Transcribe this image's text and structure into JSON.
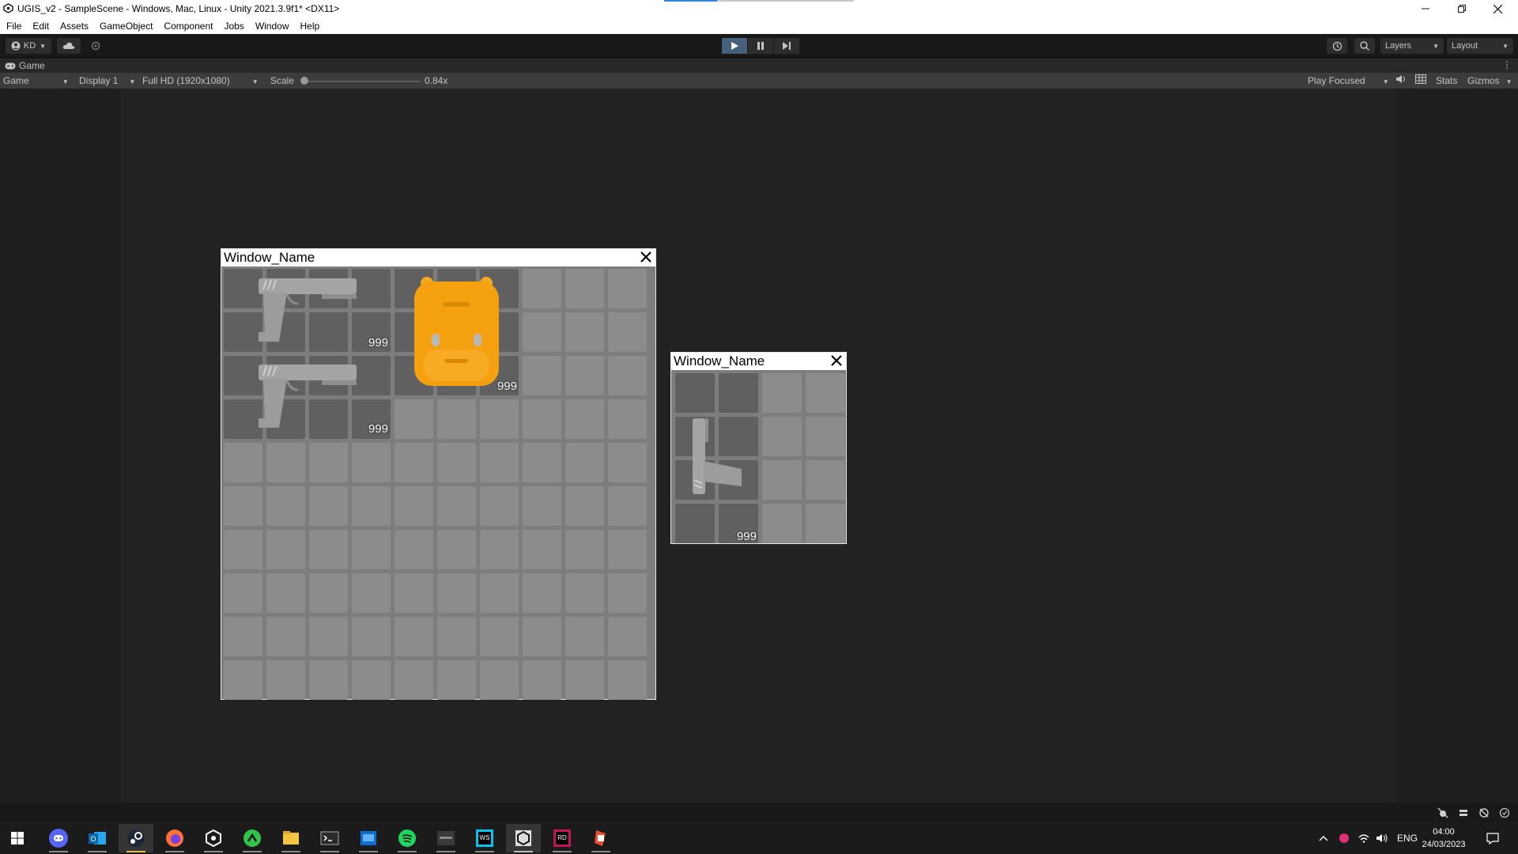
{
  "window": {
    "title": "UGIS_v2 - SampleScene - Windows, Mac, Linux - Unity 2021.3.9f1* <DX11>",
    "loading_progress": 0.28
  },
  "menu": [
    "File",
    "Edit",
    "Assets",
    "GameObject",
    "Component",
    "Jobs",
    "Window",
    "Help"
  ],
  "toolbar": {
    "account": "KD",
    "layers_label": "Layers",
    "layout_label": "Layout",
    "play_state": "playing"
  },
  "game_tab": {
    "label": "Game"
  },
  "game_bar": {
    "view_mode": "Game",
    "display": "Display 1",
    "resolution": "Full HD (1920x1080)",
    "scale_label": "Scale",
    "scale_value": "0.84x",
    "play_mode": "Play Focused",
    "stats": "Stats",
    "gizmos": "Gizmos"
  },
  "inventories": [
    {
      "name": "Window_Name",
      "columns": 10,
      "rows": 10,
      "occupied": [
        [
          0,
          0
        ],
        [
          1,
          0
        ],
        [
          2,
          0
        ],
        [
          3,
          0
        ],
        [
          4,
          0
        ],
        [
          5,
          0
        ],
        [
          6,
          0
        ],
        [
          0,
          1
        ],
        [
          1,
          1
        ],
        [
          2,
          1
        ],
        [
          3,
          1
        ],
        [
          4,
          1
        ],
        [
          5,
          1
        ],
        [
          6,
          1
        ],
        [
          0,
          2
        ],
        [
          1,
          2
        ],
        [
          2,
          2
        ],
        [
          3,
          2
        ],
        [
          4,
          2
        ],
        [
          5,
          2
        ],
        [
          6,
          2
        ],
        [
          0,
          3
        ],
        [
          1,
          3
        ],
        [
          2,
          3
        ],
        [
          3,
          3
        ]
      ],
      "items": [
        {
          "type": "pistol",
          "count": "999"
        },
        {
          "type": "pistol",
          "count": "999"
        },
        {
          "type": "backpack",
          "count": "999"
        }
      ]
    },
    {
      "name": "Window_Name",
      "columns": 4,
      "rows": 4,
      "occupied": [
        [
          0,
          0
        ],
        [
          1,
          0
        ],
        [
          0,
          1
        ],
        [
          1,
          1
        ],
        [
          0,
          2
        ],
        [
          1,
          2
        ],
        [
          0,
          3
        ],
        [
          1,
          3
        ]
      ],
      "items": [
        {
          "type": "pistol-rotated",
          "count": "999"
        }
      ]
    }
  ],
  "colors": {
    "cell": "#8c8c8c",
    "cell_occupied": "#606060",
    "backpack": "#f59a0c",
    "pistol": "#9a9a9a"
  },
  "taskbar": {
    "apps": [
      "windows-start-icon",
      "discord-icon",
      "outlook-icon",
      "steam-icon",
      "firefox-icon",
      "unity-hub-icon",
      "git-client-icon",
      "file-explorer-icon",
      "terminal-icon",
      "editor-icon",
      "spotify-icon",
      "sonos-icon",
      "webstorm-icon",
      "unity-icon",
      "rider-icon",
      "jetbrains-icon"
    ],
    "active_app": "unity-icon",
    "language": "ENG",
    "time": "04:00",
    "date": "24/03/2023"
  }
}
